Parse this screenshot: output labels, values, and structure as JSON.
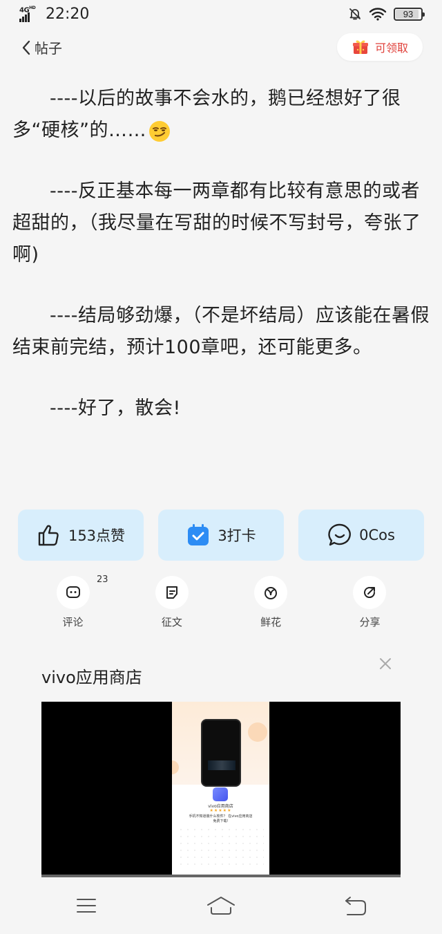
{
  "status_bar": {
    "network": "4G",
    "network_sub": "HD",
    "time": "22:20",
    "battery_level": "93",
    "icons": [
      "signal-icon",
      "mute-bell-icon",
      "wifi-icon",
      "battery-icon"
    ]
  },
  "header": {
    "back_label": "帖子",
    "claim_label": "可领取",
    "claim_icon": "gift-icon"
  },
  "article": {
    "paragraphs": [
      "----以后的故事不会水的，鹅已经想好了很多“硬核”的……",
      "----反正基本每一两章都有比较有意思的或者超甜的，（我尽量在写甜的时候不写封号，夸张了啊)",
      "----结局够劲爆，（不是坏结局）应该能在暑假结束前完结，预计100章吧，还可能更多。",
      "----好了，散会!"
    ],
    "emoji": "smirk-emoji"
  },
  "actions": {
    "like_label": "153点赞",
    "checkin_label": "3打卡",
    "cos_label": "0Cos"
  },
  "mini_actions": {
    "comment_label": "评论",
    "comment_count": "23",
    "essay_label": "征文",
    "flower_label": "鲜花",
    "share_label": "分享"
  },
  "ad": {
    "title": "vivo应用商店",
    "brand": "vivo应用商店",
    "stars": "★★★★★",
    "caption": "手机不知道装什么软件？ 在vivo应用商店免费下载!"
  },
  "colors": {
    "card_bg": "#d8eefc",
    "accent_red": "#e0403a",
    "checkin_blue": "#2c8cf4"
  }
}
